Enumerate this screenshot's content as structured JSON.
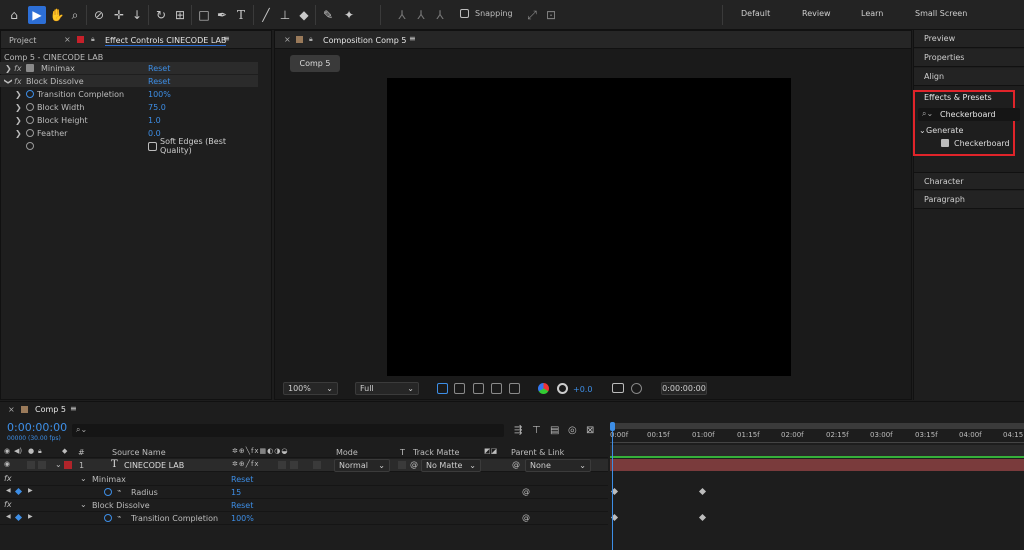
{
  "toolbar": {
    "icons": [
      "home-icon",
      "selection-tool-icon",
      "hand-tool-icon",
      "zoom-tool-icon",
      "orbit-camera-icon",
      "pan-camera-icon",
      "dolly-camera-icon",
      "rotation-tool-icon",
      "pan-behind-tool-icon",
      "rectangle-tool-icon",
      "pen-tool-icon",
      "type-tool-icon",
      "brush-tool-icon",
      "clone-stamp-icon",
      "eraser-icon",
      "roto-brush-icon",
      "puppet-pin-icon"
    ],
    "snapping_label": "Snapping",
    "workspaces": [
      "Default",
      "Review",
      "Learn",
      "Small Screen"
    ]
  },
  "project_panel": {
    "tab_project": "Project",
    "tab_effect_controls": "Effect Controls CINECODE LAB",
    "breadcrumb": "Comp 5 - CINECODE LAB",
    "effects": [
      {
        "name": "Minimax",
        "reset": "Reset"
      },
      {
        "name": "Block Dissolve",
        "reset": "Reset"
      }
    ],
    "properties": [
      {
        "label": "Transition Completion",
        "value": "100%"
      },
      {
        "label": "Block Width",
        "value": "75.0"
      },
      {
        "label": "Block Height",
        "value": "1.0"
      },
      {
        "label": "Feather",
        "value": "0.0"
      }
    ],
    "soft_edges_label": "Soft Edges (Best Quality)"
  },
  "composition": {
    "tab_label": "Composition Comp 5",
    "comp_tab": "Comp 5",
    "zoom": "100%",
    "resolution": "Full",
    "exposure": "+0.0",
    "timecode": "0:00:00:00"
  },
  "right_panel": {
    "items_top": [
      "Preview",
      "Properties",
      "Align"
    ],
    "effects_presets_title": "Effects & Presets",
    "search_value": "Checkerboard",
    "category": "Generate",
    "result": "Checkerboard",
    "items_bottom": [
      "Character",
      "Paragraph"
    ]
  },
  "timeline": {
    "tab_label": "Comp 5",
    "timecode": "0:00:00:00",
    "frame_info": "00000 (30.00 fps)",
    "headers": {
      "num": "#",
      "source_name": "Source Name",
      "mode": "Mode",
      "t": "T",
      "track_matte": "Track Matte",
      "parent_link": "Parent & Link"
    },
    "layer": {
      "num": "1",
      "name": "CINECODE LAB",
      "mode": "Normal",
      "track_matte": "No Matte",
      "parent": "None"
    },
    "rows": [
      {
        "name": "Minimax",
        "value": "Reset"
      },
      {
        "name": "Radius",
        "value": "15"
      },
      {
        "name": "Block Dissolve",
        "value": "Reset"
      },
      {
        "name": "Transition Completion",
        "value": "100%"
      }
    ],
    "fx_label": "fx",
    "ruler": [
      "0:00f",
      "00:15f",
      "01:00f",
      "01:15f",
      "02:00f",
      "02:15f",
      "03:00f",
      "03:15f",
      "04:00f",
      "04:15"
    ]
  },
  "colors": {
    "accent": "#2d6fd6",
    "value_blue": "#3d8ee6",
    "highlight_box": "#e0242a",
    "layer_bar": "#7a3b3c",
    "track_green": "#36b03a"
  }
}
